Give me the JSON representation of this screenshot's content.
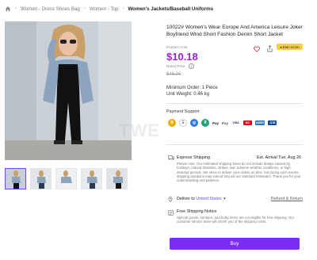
{
  "breadcrumb": {
    "items": [
      "Women - Dress Shoes Bag",
      "Women - Top",
      "Women's Jackets/Baseball Uniforms"
    ]
  },
  "product": {
    "title": "10022# Women's Wear Europe And America Leisure Joker Boyfriend Wind Short Fashion Denim Short Jacket",
    "product_cost_label": "Product Cost",
    "price": "$10.18",
    "retail_price_label": "Retail Price",
    "retail_price": "$48.00",
    "info_glyph": "i",
    "minimum_order": "Minimum Order: 1 Piece",
    "unit_weight": "Unit Weight: 0.46 kg",
    "earn_button": "Earn eCoin"
  },
  "payment": {
    "title": "Payment Support",
    "methods": [
      "B",
      "Ξ",
      "◎",
      "₮",
      "Pay",
      "Pay",
      "VISA",
      "MC",
      "AMEX",
      "JCB"
    ]
  },
  "shipping": {
    "title": "Express Shipping",
    "arrival": "Est. Arrival Tue, Aug 26",
    "note": "Please note: Our estimated shipping times do not include delays caused by holidays, natural disasters, strikes, war, adverse weather conditions, or high demand periods. We strive to deliver your orders on time, but during such events, shipping durations may extend beyond our standard estimates. Thank you for your understanding and patience."
  },
  "delivery": {
    "deliver_to_label": "Deliver to",
    "country": "United States",
    "caret": "▼",
    "refund_link": "Refund & Return"
  },
  "free_shipping": {
    "title": "Free Shipping Notice",
    "note": "Special goods, furniture, and bulky items are not eligible for free shipping. Our customer service team will inform you of the shipping costs."
  },
  "buy_label": "Buy",
  "watermark": "TWE",
  "colors": {
    "accent": "#7a2df0",
    "price": "#a020d6",
    "earn": "#f7d046"
  }
}
